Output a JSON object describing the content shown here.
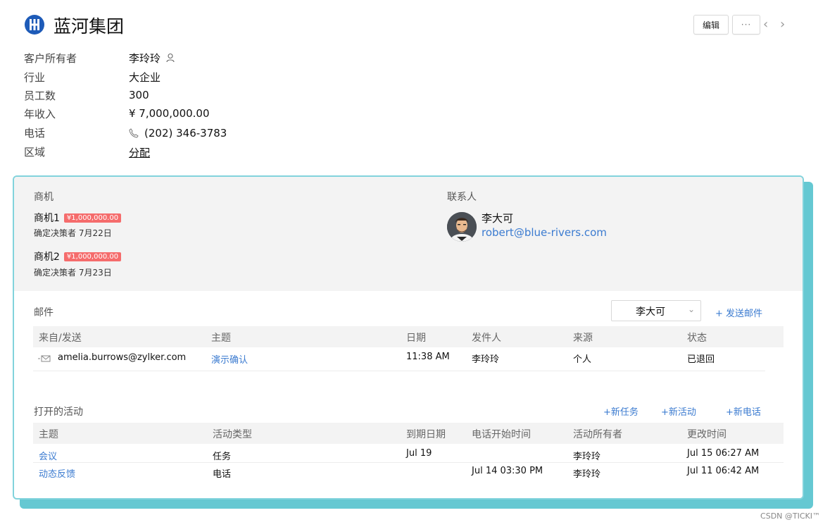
{
  "company": {
    "name": "蓝河集团"
  },
  "header_buttons": {
    "edit": "编辑",
    "more": "···",
    "prev": "‹",
    "next": "›"
  },
  "info": {
    "owner_label": "客户所有者",
    "owner_value": "李玲玲",
    "industry_label": "行业",
    "industry_value": "大企业",
    "employees_label": "员工数",
    "employees_value": "300",
    "revenue_label": "年收入",
    "revenue_value": "¥ 7,000,000.00",
    "phone_label": "电话",
    "phone_value": "(202) 346-3783",
    "region_label": "区域",
    "region_value": "分配"
  },
  "deals": {
    "title": "商机",
    "items": [
      {
        "name": "商机1",
        "amount": "¥1,000,000.00",
        "stage": "确定决策者 7月22日"
      },
      {
        "name": "商机2",
        "amount": "¥1,000,000.00",
        "stage": "确定决策者 7月23日"
      }
    ]
  },
  "contacts": {
    "title": "联系人",
    "name": "李大可",
    "email": "robert@blue-rivers.com"
  },
  "mail": {
    "title": "邮件",
    "selected_contact": "李大可",
    "send_link": "+ 发送邮件",
    "columns": [
      "来自/发送",
      "主题",
      "日期",
      "发件人",
      "来源",
      "状态"
    ],
    "rows": [
      {
        "from": "amelia.burrows@zylker.com",
        "subject": "演示确认",
        "date": "11:38 AM",
        "sender": "李玲玲",
        "source": "个人",
        "status": "已退回"
      }
    ]
  },
  "activities": {
    "title": "打开的活动",
    "new_task": "+新任务",
    "new_event": "+新活动",
    "new_call": "+新电话",
    "columns": [
      "主题",
      "活动类型",
      "到期日期",
      "电话开始时间",
      "活动所有者",
      "更改时间"
    ],
    "rows": [
      {
        "subject": "会议",
        "type": "任务",
        "due": "Jul 19",
        "call_start": "",
        "owner": "李玲玲",
        "modified": "Jul 15 06:27 AM"
      },
      {
        "subject": "动态反馈",
        "type": "电话",
        "due": "",
        "call_start": "Jul 14 03:30 PM",
        "owner": "李玲玲",
        "modified": "Jul 11 06:42 AM"
      }
    ]
  },
  "watermark": "CSDN @TICKI™",
  "colors": {
    "accent_blue": "#3b7bd0",
    "badge_red": "#f56c6c",
    "card_border": "#82d3dc",
    "card_shadow": "#65c8d2"
  }
}
